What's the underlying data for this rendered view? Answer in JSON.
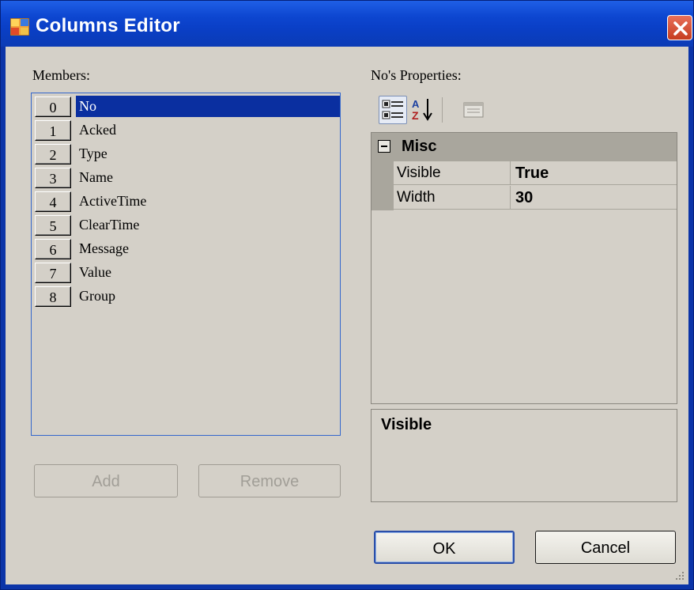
{
  "window": {
    "title": "Columns Editor"
  },
  "members": {
    "label": "Members:",
    "items": [
      {
        "index": "0",
        "name": "No",
        "selected": true
      },
      {
        "index": "1",
        "name": "Acked"
      },
      {
        "index": "2",
        "name": "Type"
      },
      {
        "index": "3",
        "name": "Name"
      },
      {
        "index": "4",
        "name": "ActiveTime"
      },
      {
        "index": "5",
        "name": "ClearTime"
      },
      {
        "index": "6",
        "name": "Message"
      },
      {
        "index": "7",
        "name": "Value"
      },
      {
        "index": "8",
        "name": "Group"
      }
    ]
  },
  "buttons": {
    "add": "Add",
    "remove": "Remove",
    "ok": "OK",
    "cancel": "Cancel"
  },
  "properties": {
    "label": "No's Properties:",
    "category": "Misc",
    "rows": [
      {
        "name": "Visible",
        "value": "True"
      },
      {
        "name": "Width",
        "value": "30"
      }
    ],
    "description_title": "Visible"
  },
  "toolbar": {
    "icons": [
      "categorized-icon",
      "alphabetical-sort-icon",
      "property-pages-icon"
    ]
  },
  "colors": {
    "title_bar": "#0a3fc6",
    "selection": "#0a2fa0",
    "close_button": "#c63d1f"
  }
}
